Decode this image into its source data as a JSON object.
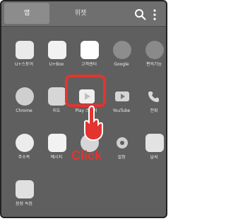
{
  "tabs": [
    {
      "label": "앱"
    },
    {
      "label": "위젯"
    }
  ],
  "apps": [
    {
      "label": "U+스토어",
      "icon": "u-plus-store-icon"
    },
    {
      "label": "U+Box",
      "icon": "cloud-box-icon"
    },
    {
      "label": "고객센터",
      "icon": "customer-center-icon"
    },
    {
      "label": "Google",
      "icon": "google-folder-icon"
    },
    {
      "label": "편의기능",
      "icon": "utility-folder-icon"
    },
    {
      "label": "Chrome",
      "icon": "chrome-icon"
    },
    {
      "label": "지도",
      "icon": "maps-icon"
    },
    {
      "label": "Play 스토어",
      "icon": "play-store-icon"
    },
    {
      "label": "YouTube",
      "icon": "youtube-icon"
    },
    {
      "label": "전화",
      "icon": "phone-icon"
    },
    {
      "label": "주소록",
      "icon": "contacts-icon"
    },
    {
      "label": "메시지",
      "icon": "messages-icon"
    },
    {
      "label": "",
      "icon": "camera-icon"
    },
    {
      "label": "설정",
      "icon": "settings-icon"
    },
    {
      "label": "날씨",
      "icon": "weather-icon"
    },
    {
      "label": "음성 녹음",
      "icon": "voice-recorder-icon"
    }
  ],
  "annotation": {
    "click_text": "Click"
  },
  "colors": {
    "accent": "#e3342f",
    "background": "#5f5f5f"
  }
}
